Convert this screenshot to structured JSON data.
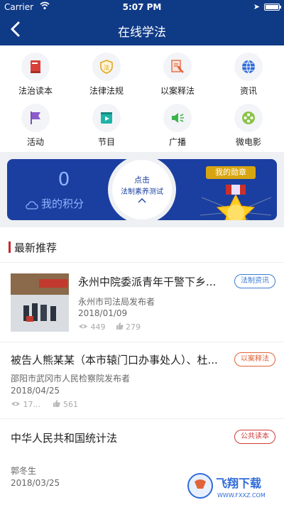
{
  "status": {
    "carrier": "Carrier",
    "time": "5:07 PM"
  },
  "nav": {
    "title": "在线学法"
  },
  "grid": [
    {
      "label": "法治读本",
      "icon": "book-icon"
    },
    {
      "label": "法律法规",
      "icon": "shield-law-icon"
    },
    {
      "label": "以案释法",
      "icon": "case-document-icon"
    },
    {
      "label": "资讯",
      "icon": "globe-icon"
    },
    {
      "label": "活动",
      "icon": "flag-icon"
    },
    {
      "label": "节目",
      "icon": "play-icon"
    },
    {
      "label": "广播",
      "icon": "broadcast-icon"
    },
    {
      "label": "微电影",
      "icon": "film-reel-icon"
    }
  ],
  "banner": {
    "score": "0",
    "score_label": "我的积分",
    "test_line1": "点击",
    "test_line2": "法制素养测试",
    "medal_label": "我的勋章"
  },
  "section": {
    "title": "最新推荐"
  },
  "news": [
    {
      "title": "永州中院委派青年干警下乡...",
      "publisher": "永州市司法局发布者",
      "date": "2018/01/09",
      "views": "449",
      "likes": "279",
      "tag": "法制资讯",
      "tag_color": "#3a7bd5"
    },
    {
      "title": "被告人熊某某（本市辕门口办事处人）、杜...",
      "publisher": "邵阳市武冈市人民检察院发布者",
      "date": "2018/04/25",
      "views": "17...",
      "likes": "561",
      "tag": "以案释法",
      "tag_color": "#e0643a"
    },
    {
      "title": "中华人民共和国统计法",
      "publisher": "郭冬生",
      "date": "2018/03/25",
      "tag": "公共读本",
      "tag_color": "#d23a3a"
    }
  ],
  "watermark": {
    "text": "飞翔下载",
    "url": "WWW.FXXZ.COM"
  }
}
